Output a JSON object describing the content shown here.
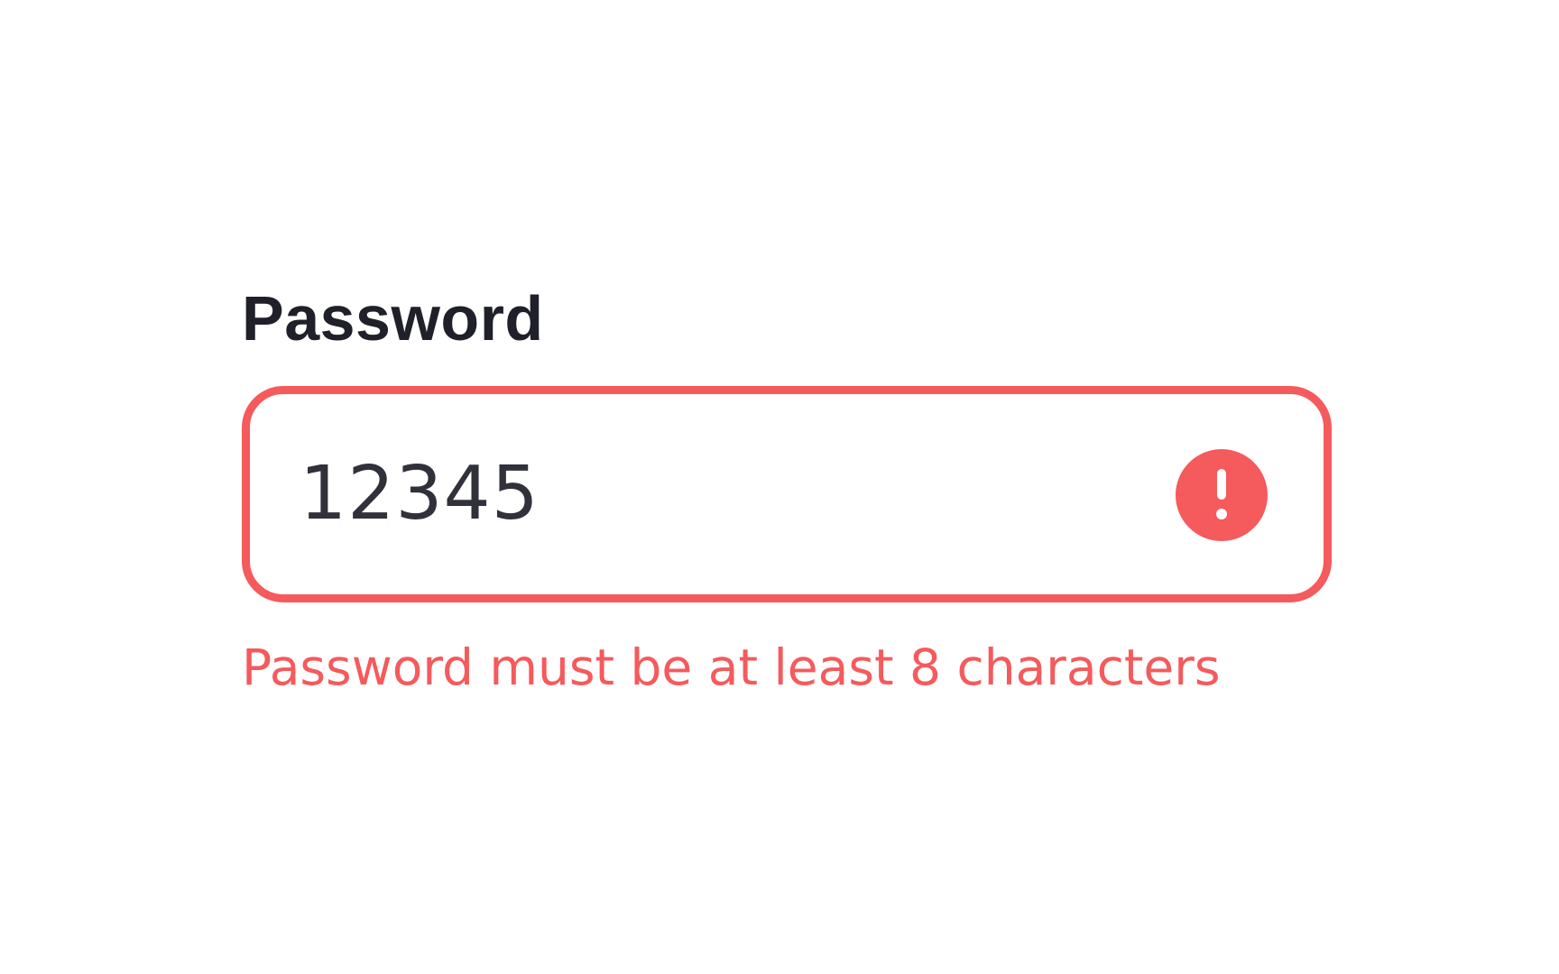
{
  "field": {
    "label": "Password",
    "value": "12345",
    "error_message": "Password must be at least 8 characters",
    "status": "error",
    "icon": "alert-circle-icon"
  },
  "colors": {
    "error": "#f55a5c",
    "label": "#1f2029",
    "value_text": "#30313b",
    "background": "#ffffff"
  }
}
